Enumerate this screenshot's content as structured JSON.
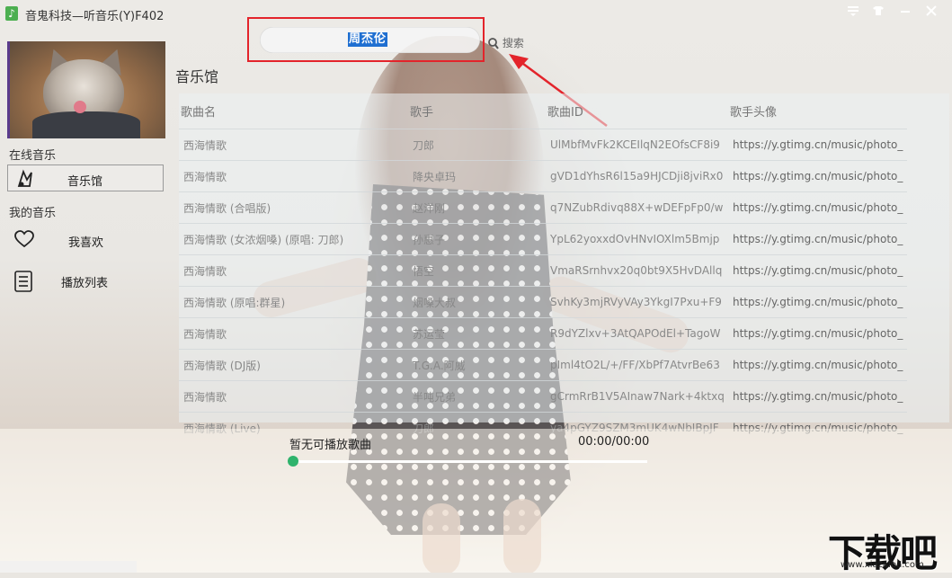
{
  "window": {
    "icon_glyph": "♪",
    "title": "音鬼科技—听音乐(Y)F402",
    "controls": [
      "menu-icon",
      "skin-icon",
      "minimize-icon",
      "close-icon"
    ]
  },
  "search": {
    "value": "周杰伦",
    "button_label": "搜索"
  },
  "sidebar": {
    "online_section": "在线音乐",
    "online_items": [
      {
        "label": "音乐馆",
        "icon": "music-hall-icon"
      }
    ],
    "my_section": "我的音乐",
    "my_items": [
      {
        "label": "我喜欢",
        "icon": "heart-icon"
      },
      {
        "label": "播放列表",
        "icon": "playlist-icon"
      }
    ]
  },
  "main": {
    "title": "音乐馆",
    "columns": [
      "歌曲名",
      "歌手",
      "歌曲ID",
      "歌手头像"
    ],
    "rows": [
      {
        "title": "西海情歌",
        "artist": "刀郎",
        "id": "UlMbfMvFk2KCEIlqN2EOfsCF8i9",
        "avatar": "https://y.gtimg.cn/music/photo_"
      },
      {
        "title": "西海情歌",
        "artist": "降央卓玛",
        "id": "gVD1dYhsR6l15a9HJCDji8jviRx0",
        "avatar": "https://y.gtimg.cn/music/photo_"
      },
      {
        "title": "西海情歌 (合唱版)",
        "artist": "赵洋刚",
        "id": "q7NZubRdivq88X+wDEFpFp0/w",
        "avatar": "https://y.gtimg.cn/music/photo_"
      },
      {
        "title": "西海情歌 (女浓烟嗓) (原唱: 刀郎)",
        "artist": "孙惠子",
        "id": "YpL62yoxxdOvHNvIOXlm5Bmjp",
        "avatar": "https://y.gtimg.cn/music/photo_"
      },
      {
        "title": "西海情歌",
        "artist": "悟空",
        "id": "VmaRSrnhvx20q0bt9X5HvDAllq",
        "avatar": "https://y.gtimg.cn/music/photo_"
      },
      {
        "title": "西海情歌 (原唱:群星)",
        "artist": "烟嗓大叔",
        "id": "SvhKy3mjRVyVAy3YkgI7Pxu+F9",
        "avatar": "https://y.gtimg.cn/music/photo_"
      },
      {
        "title": "西海情歌",
        "artist": "苏运莹",
        "id": "R9dYZlxv+3AtQAPOdEl+TagoW",
        "avatar": "https://y.gtimg.cn/music/photo_"
      },
      {
        "title": "西海情歌 (DJ版)",
        "artist": "T.G.A.阿威",
        "id": "pIml4tO2L/+/FF/XbPf7AtvrBe63",
        "avatar": "https://y.gtimg.cn/music/photo_"
      },
      {
        "title": "西海情歌",
        "artist": "半吨兄弟",
        "id": "gCrmRrB1V5AInaw7Nark+4ktxq",
        "avatar": "https://y.gtimg.cn/music/photo_"
      },
      {
        "title": "西海情歌 (Live)",
        "artist": "刀郎",
        "id": "ya4pGYZ9SZM3mUK4wNbIBpJF",
        "avatar": "https://y.gtimg.cn/music/photo_"
      }
    ]
  },
  "player": {
    "now_playing": "暂无可播放歌曲",
    "time": "00:00/00:00",
    "progress": 0
  },
  "watermark": {
    "main": "下载吧",
    "sub": "www.xiazaiba.com"
  },
  "colors": {
    "accent": "#2fb36c",
    "annotation": "#e3242b",
    "selection": "#1f6fd1"
  }
}
